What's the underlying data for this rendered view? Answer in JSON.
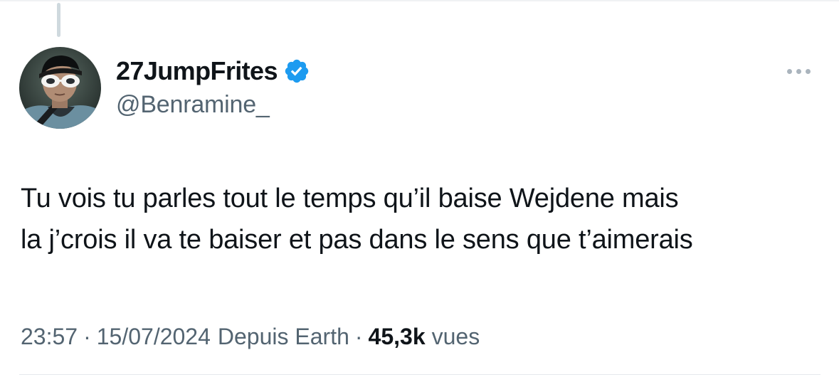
{
  "tweet": {
    "author": {
      "display_name": "27JumpFrites",
      "handle": "@Benramine_",
      "verified": true,
      "verified_badge_color": "#1d9bf0"
    },
    "text_lines": [
      "Tu vois tu parles tout le temps qu’il baise Wejdene mais",
      "la j’crois il va te baiser et pas dans le sens que t’aimerais"
    ],
    "meta": {
      "time": "23:57",
      "separator": "·",
      "date": "15/07/2024",
      "source": "Depuis Earth",
      "views_count": "45,3k",
      "views_label": "vues"
    },
    "icons": {
      "more": "more-horizontal-icon",
      "verified": "verified-badge-icon"
    }
  }
}
